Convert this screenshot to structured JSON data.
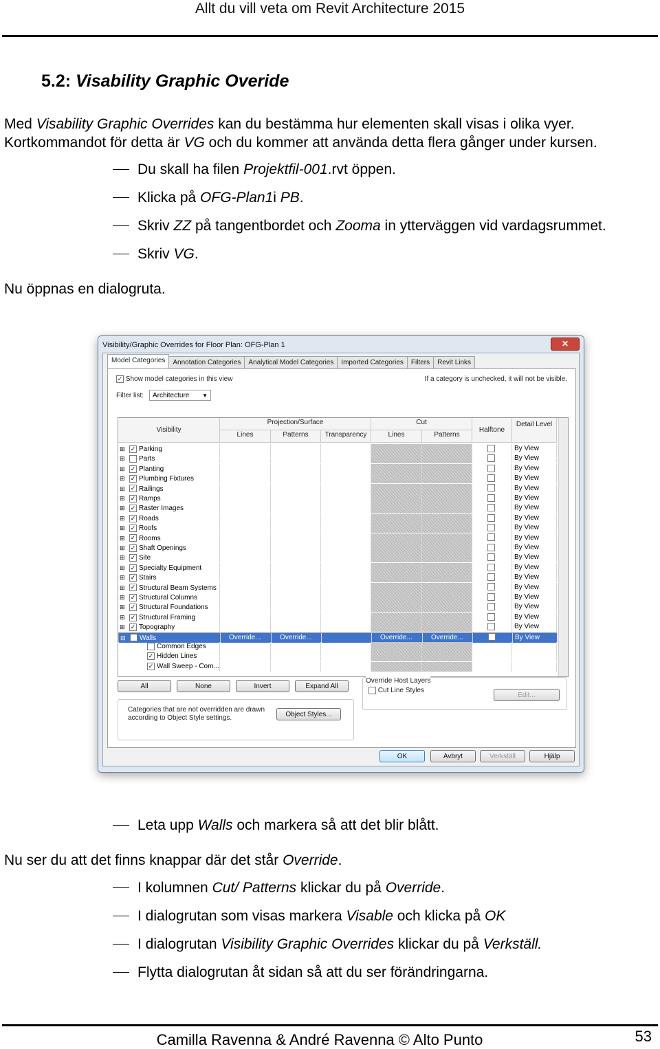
{
  "header": {
    "running_title": "Allt du vill veta om Revit Architecture 2015"
  },
  "section": {
    "number": "5.2:",
    "title": "Visability Graphic Overide"
  },
  "intro": {
    "line1": {
      "a": "Med ",
      "b": "Visability Graphic Overrides",
      "c": " kan du bestämma hur elementen skall visas i olika vyer."
    },
    "line2": {
      "a": "Kortkommandot för detta är ",
      "b": "VG",
      "c": " och du kommer att använda detta flera gånger under kursen."
    }
  },
  "steps1": [
    {
      "a": "Du skall ha filen ",
      "b": "Projektfil-001",
      "c": ".rvt öppen.",
      "d": "",
      "e": ""
    },
    {
      "a": "Klicka på ",
      "b": "OFG-Plan1",
      "c": "i ",
      "d": "PB",
      "e": "."
    },
    {
      "a": "Skriv ",
      "b": "ZZ",
      "c": " på tangentbordet och ",
      "d": "Zooma",
      "e": " in ytterväggen vid vardagsrummet."
    },
    {
      "a": "Skriv ",
      "b": "VG",
      "c": ".",
      "d": "",
      "e": ""
    }
  ],
  "para_dialog": "Nu öppnas en dialogruta.",
  "dialog": {
    "title": "Visibility/Graphic Overrides for Floor Plan: OFG-Plan 1",
    "close": "✕",
    "tabs": [
      "Model Categories",
      "Annotation Categories",
      "Analytical Model Categories",
      "Imported Categories",
      "Filters",
      "Revit Links"
    ],
    "show_model": "Show model categories in this view",
    "note_unchecked": "If a category is unchecked, it will not be visible.",
    "filter_label": "Filter list:",
    "filter_value": "Architecture",
    "columns": {
      "visibility": "Visibility",
      "projection": "Projection/Surface",
      "cut": "Cut",
      "lines": "Lines",
      "patterns": "Patterns",
      "transparency": "Transparency",
      "halftone": "Halftone",
      "detail_level": "Detail Level"
    },
    "rows": [
      {
        "name": "Parking",
        "checked": true
      },
      {
        "name": "Parts",
        "checked": false
      },
      {
        "name": "Planting",
        "checked": true
      },
      {
        "name": "Plumbing Fixtures",
        "checked": true
      },
      {
        "name": "Railings",
        "checked": true
      },
      {
        "name": "Ramps",
        "checked": true
      },
      {
        "name": "Raster Images",
        "checked": true
      },
      {
        "name": "Roads",
        "checked": true
      },
      {
        "name": "Roofs",
        "checked": true
      },
      {
        "name": "Rooms",
        "checked": true
      },
      {
        "name": "Shaft Openings",
        "checked": true
      },
      {
        "name": "Site",
        "checked": true
      },
      {
        "name": "Specialty Equipment",
        "checked": true
      },
      {
        "name": "Stairs",
        "checked": true
      },
      {
        "name": "Structural Beam Systems",
        "checked": true
      },
      {
        "name": "Structural Columns",
        "checked": true
      },
      {
        "name": "Structural Foundations",
        "checked": true
      },
      {
        "name": "Structural Framing",
        "checked": true
      },
      {
        "name": "Topography",
        "checked": true
      },
      {
        "name": "Walls",
        "checked": true,
        "selected": true
      },
      {
        "name": "Common Edges",
        "checked": false,
        "sub": true
      },
      {
        "name": "Hidden Lines",
        "checked": true,
        "sub": true
      },
      {
        "name": "Wall Sweep - Com...",
        "checked": true,
        "sub": true
      }
    ],
    "by_view": "By View",
    "override": "Override...",
    "buttons": {
      "all": "All",
      "none": "None",
      "invert": "Invert",
      "expand_all": "Expand All"
    },
    "host_layers": {
      "title": "Override Host Layers",
      "cut_line_styles": "Cut Line Styles",
      "edit": "Edit..."
    },
    "not_overridden_note_1": "Categories that are not overridden are drawn",
    "not_overridden_note_2": "according to Object Style settings.",
    "object_styles": "Object Styles...",
    "footer_buttons": {
      "ok": "OK",
      "cancel": "Avbryt",
      "apply": "Verkställ",
      "help": "Hjälp"
    }
  },
  "steps2": [
    {
      "a": "Leta upp ",
      "b": "Walls",
      "c": " och markera så att det blir blått.",
      "d": "",
      "e": ""
    }
  ],
  "para_override": {
    "a": "Nu ser du att det finns knappar där det står ",
    "b": "Override",
    "c": "."
  },
  "steps3": [
    {
      "a": "I kolumnen ",
      "b": "Cut/ Patterns",
      "c": " klickar du på ",
      "d": "Override",
      "e": "."
    },
    {
      "a": "I dialogrutan som visas markera ",
      "b": "Visable",
      "c": " och klicka på ",
      "d": "OK",
      "e": ""
    },
    {
      "a": "I dialogrutan ",
      "b": "Visibility Graphic Overrides",
      "c": " klickar du på ",
      "d": "Verkställ.",
      "e": ""
    },
    {
      "a": "Flytta dialogrutan åt sidan så att du ser förändringarna.",
      "b": "",
      "c": "",
      "d": "",
      "e": ""
    }
  ],
  "footer": {
    "authors": "Camilla Ravenna & André Ravenna © Alto Punto",
    "page": "53"
  }
}
